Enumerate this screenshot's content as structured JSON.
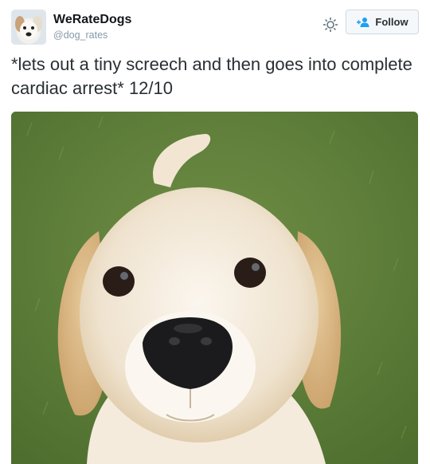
{
  "account": {
    "display_name": "WeRateDogs",
    "handle": "@dog_rates"
  },
  "follow_button": {
    "label": "Follow",
    "icon": "add-user-icon"
  },
  "settings_icon": "gear-icon",
  "tweet": {
    "text": "*lets out a tiny screech and then goes into complete cardiac arrest* 12/10"
  },
  "media": {
    "subject": "golden retriever puppy on grass"
  },
  "colors": {
    "follow_accent": "#1da1f2",
    "text": "#292f33",
    "handle": "#8899a6"
  }
}
